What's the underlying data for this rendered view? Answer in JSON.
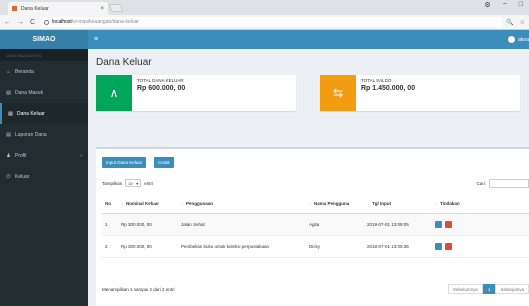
{
  "browser": {
    "tab_title": "Dana Keluar",
    "tab_close": "×",
    "win_min": "−",
    "win_user": "⚙",
    "win_max": "□",
    "nav_back": "←",
    "nav_forward": "→",
    "nav_reload": "C",
    "url_host": "localhost",
    "url_path": "/si-mas/keuangan/dana-keluar",
    "zoom_icon": "🔍",
    "star_icon": "☆"
  },
  "app": {
    "logo": "SIMAO",
    "toggle": "≡",
    "user_name": "akoa"
  },
  "sidebar": {
    "header": "MAIN NAVIGATION",
    "items": [
      {
        "icon": "⌂",
        "label": "Beranda"
      },
      {
        "icon": "▤",
        "label": "Dana Masuk"
      },
      {
        "icon": "▤",
        "label": "Dana Keluar"
      },
      {
        "icon": "▤",
        "label": "Laporan Dana"
      },
      {
        "icon": "♟",
        "label": "Profil",
        "chevron": "‹"
      },
      {
        "icon": "⏻",
        "label": "Keluar"
      }
    ]
  },
  "page": {
    "title": "Dana Keluar"
  },
  "infoboxes": [
    {
      "label": "TOTAL DANA KELUAR",
      "value": "Rp 600.000, 00",
      "icon": "∧",
      "color": "#00a65a"
    },
    {
      "label": "TOTAL SALDO",
      "value": "Rp 1.450.000, 00",
      "icon": "⇆",
      "color": "#f39c12"
    }
  ],
  "actions": {
    "input": "Input Dana Keluar",
    "print": "Cetak"
  },
  "table_controls": {
    "show_label": "Tampilkan",
    "show_value": "10",
    "show_suffix": "entri",
    "search_label": "Cari:"
  },
  "table": {
    "columns": [
      "No",
      "Nominal Keluar",
      "Penggunaan",
      "Nama Pengguna",
      "Tgl Input",
      "Tindakan"
    ],
    "rows": [
      [
        "1",
        "Rp 300.000, 00",
        "Jalan Sehat",
        "Agita",
        "2018-07-01 13:09:05"
      ],
      [
        "2",
        "Rp 300.000, 00",
        "Pembelian buku untuk koleksi perpustakaan",
        "Dicky",
        "2018-07-01 13:05:36"
      ]
    ]
  },
  "footer": {
    "info": "Menampilkan 1 sampai 2 dari 2 entri",
    "prev": "Sebelumnya",
    "page": "1",
    "next": "Selanjutnya"
  }
}
